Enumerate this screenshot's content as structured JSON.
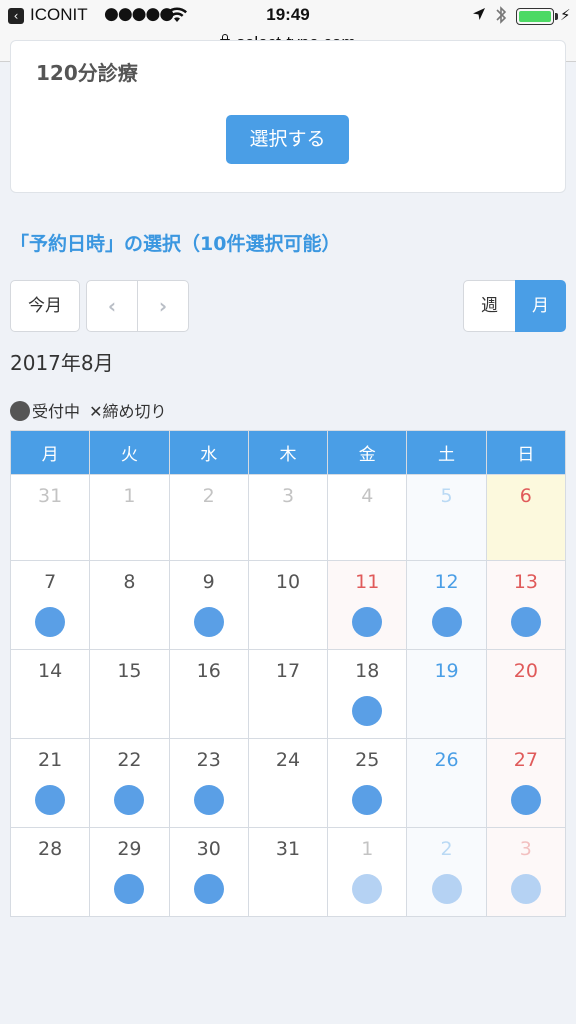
{
  "status_bar": {
    "carrier": "ICONIT",
    "signal": "●●●●●",
    "time": "19:49",
    "url": "select-type.com"
  },
  "menu": {
    "title": "120分診療",
    "select_label": "選択する"
  },
  "section_title": "「予約日時」の選択（10件選択可能）",
  "controls": {
    "today": "今月",
    "prev": "‹",
    "next": "›",
    "week": "週",
    "month": "月"
  },
  "month_label": "2017年8月",
  "legend": {
    "open": "受付中",
    "closed_mark": "✕",
    "closed": "締め切り"
  },
  "weekdays": [
    "月",
    "火",
    "水",
    "木",
    "金",
    "土",
    "日"
  ],
  "weeks": [
    [
      {
        "day": "31",
        "other": true,
        "avail": false
      },
      {
        "day": "1",
        "other": true,
        "avail": false
      },
      {
        "day": "2",
        "other": true,
        "avail": false
      },
      {
        "day": "3",
        "other": true,
        "avail": false
      },
      {
        "day": "4",
        "other": true,
        "avail": false
      },
      {
        "day": "5",
        "other": true,
        "avail": false
      },
      {
        "day": "6",
        "other": false,
        "avail": false,
        "today": true
      }
    ],
    [
      {
        "day": "7",
        "avail": true
      },
      {
        "day": "8",
        "avail": false
      },
      {
        "day": "9",
        "avail": true
      },
      {
        "day": "10",
        "avail": false
      },
      {
        "day": "11",
        "avail": true,
        "holiday": true
      },
      {
        "day": "12",
        "avail": true
      },
      {
        "day": "13",
        "avail": true
      }
    ],
    [
      {
        "day": "14",
        "avail": false
      },
      {
        "day": "15",
        "avail": false
      },
      {
        "day": "16",
        "avail": false
      },
      {
        "day": "17",
        "avail": false
      },
      {
        "day": "18",
        "avail": true
      },
      {
        "day": "19",
        "avail": false
      },
      {
        "day": "20",
        "avail": false
      }
    ],
    [
      {
        "day": "21",
        "avail": true
      },
      {
        "day": "22",
        "avail": true
      },
      {
        "day": "23",
        "avail": true
      },
      {
        "day": "24",
        "avail": false
      },
      {
        "day": "25",
        "avail": true
      },
      {
        "day": "26",
        "avail": false
      },
      {
        "day": "27",
        "avail": true
      }
    ],
    [
      {
        "day": "28",
        "avail": false
      },
      {
        "day": "29",
        "avail": true
      },
      {
        "day": "30",
        "avail": true
      },
      {
        "day": "31",
        "avail": false
      },
      {
        "day": "1",
        "other": true,
        "avail": true
      },
      {
        "day": "2",
        "other": true,
        "avail": true
      },
      {
        "day": "3",
        "other": true,
        "avail": true
      }
    ]
  ],
  "colors": {
    "accent": "#4a9ee6",
    "available_dot": "#5a9fe6",
    "saturday": "#4a9ee6",
    "sunday_holiday": "#e05a5a",
    "today_bg": "#fcf9dd"
  }
}
